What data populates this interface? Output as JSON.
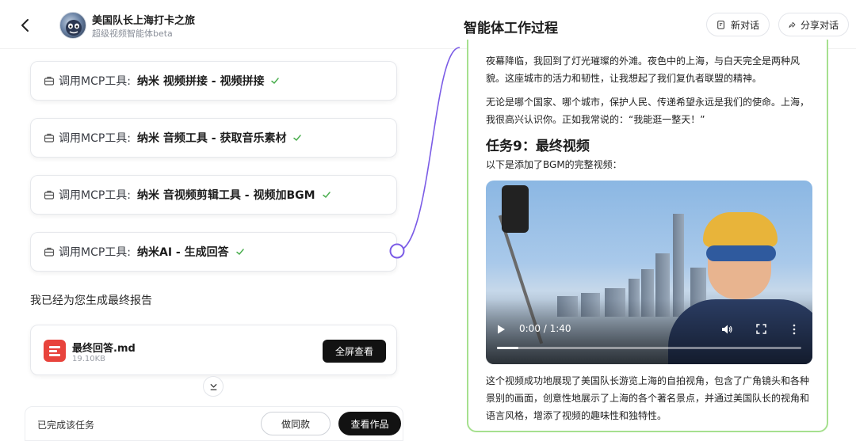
{
  "header": {
    "agent_name": "美国队长上海打卡之旅",
    "agent_subtitle": "超级视频智能体beta",
    "panel_title": "智能体工作过程",
    "new_chat_label": "新对话",
    "share_label": "分享对话"
  },
  "tool_calls": [
    {
      "prefix": "调用MCP工具:",
      "tool": "纳米 视频拼接 - 视频拼接",
      "status": "done"
    },
    {
      "prefix": "调用MCP工具:",
      "tool": "纳米 音频工具 - 获取音乐素材",
      "status": "done"
    },
    {
      "prefix": "调用MCP工具:",
      "tool": "纳米 音视频剪辑工具 - 视频加BGM",
      "status": "done"
    },
    {
      "prefix": "调用MCP工具:",
      "tool": "纳米AI - 生成回答",
      "status": "done"
    }
  ],
  "report": {
    "intro": "我已经为您生成最终报告",
    "file_name": "最终回答.md",
    "file_size": "19.10KB",
    "fullscreen_label": "全屏查看"
  },
  "bottom_bar": {
    "status": "已完成该任务",
    "same_label": "做同款",
    "view_label": "查看作品"
  },
  "panel": {
    "para1": "夜幕降临，我回到了灯光璀璨的外滩。夜色中的上海，与白天完全是两种风貌。这座城市的活力和韧性，让我想起了我们复仇者联盟的精神。",
    "para2": "无论是哪个国家、哪个城市，保护人民、传递希望永远是我们的使命。上海，我很高兴认识你。正如我常说的：“我能逛一整天！”",
    "task_title": "任务9：最终视频",
    "task_subtitle": "以下是添加了BGM的完整视频：",
    "video": {
      "time": "0:00 / 1:40",
      "progress": 0.07
    },
    "para3": "这个视频成功地展现了美国队长游览上海的自拍视角，包含了广角镜头和各种景别的画面，创意性地展示了上海的各个著名景点，并通过美国队长的视角和语言风格，增添了视频的趣味性和独特性。"
  },
  "colors": {
    "accent_green": "#a6e08f",
    "check_green": "#4caf50",
    "connector_purple": "#7b5ce6",
    "file_red": "#e8433c",
    "dark_button": "#121212"
  }
}
